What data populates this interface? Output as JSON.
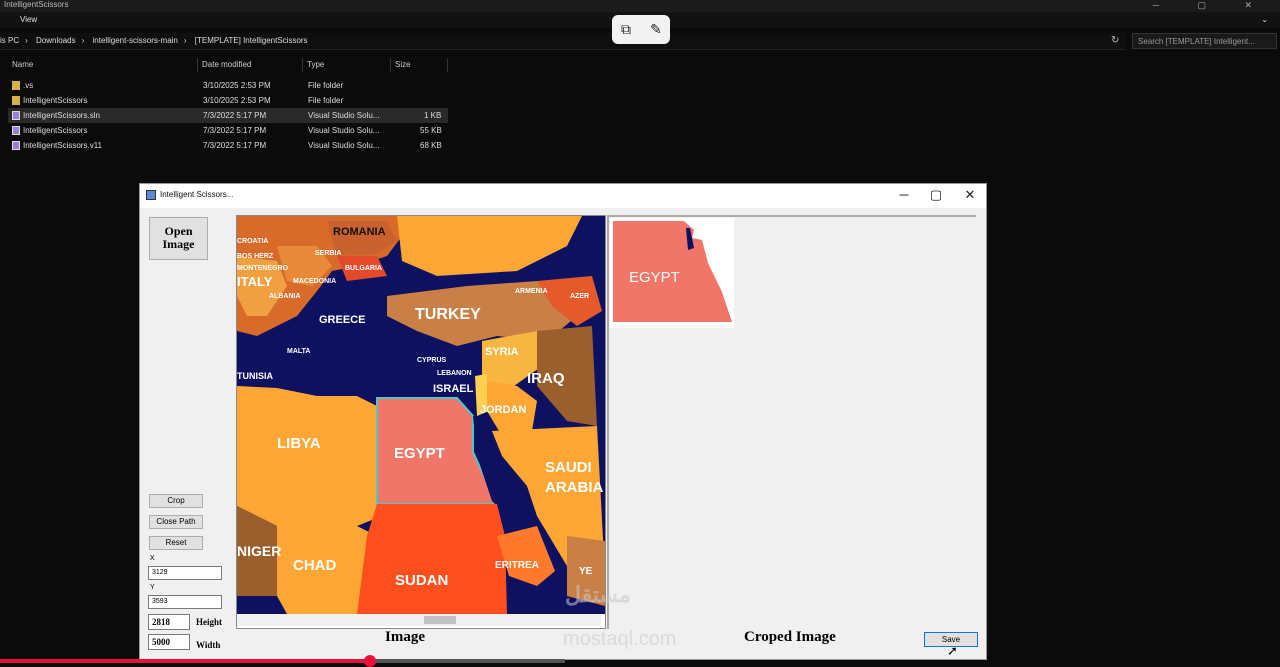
{
  "explorer": {
    "window_title": "IntelligentScissors",
    "menu_view": "View",
    "breadcrumb": [
      "is PC",
      "Downloads",
      "intelligent-scissors-main",
      "[TEMPLATE] IntelligentScissors"
    ],
    "search_placeholder": "Search [TEMPLATE] Intelligent...",
    "columns": [
      "Name",
      "Date modified",
      "Type",
      "Size"
    ],
    "files": [
      {
        "name": ".vs",
        "date": "3/10/2025 2:53 PM",
        "type": "File folder",
        "size": "",
        "icon": "folder-icon"
      },
      {
        "name": "IntelligentScissors",
        "date": "3/10/2025 2:53 PM",
        "type": "File folder",
        "size": "",
        "icon": "folder-icon"
      },
      {
        "name": "IntelligentScissors.sln",
        "date": "7/3/2022 5:17 PM",
        "type": "Visual Studio Solu...",
        "size": "1 KB",
        "icon": "solution-file-icon"
      },
      {
        "name": "IntelligentScissors",
        "date": "7/3/2022 5:17 PM",
        "type": "Visual Studio Solu...",
        "size": "55 KB",
        "icon": "solution-file-icon"
      },
      {
        "name": "IntelligentScissors.v11",
        "date": "7/3/2022 5:17 PM",
        "type": "Visual Studio Solu...",
        "size": "68 KB",
        "icon": "solution-file-icon"
      }
    ]
  },
  "app": {
    "title": "Intelligent Scissors...",
    "open_image_label": "Open Image",
    "crop_label": "Crop",
    "close_path_label": "Close Path",
    "reset_label": "Reset",
    "x_label": "X",
    "x_value": "3129",
    "y_label": "Y",
    "y_value": "3593",
    "height_value": "2818",
    "height_label": "Height",
    "width_value": "5000",
    "width_label": "Width",
    "image_caption": "Image",
    "cropped_caption": "Croped Image",
    "save_label": "Save"
  },
  "map_labels": {
    "romania": "ROMANIA",
    "serbia": "SERBIA",
    "bulgaria": "BULGARIA",
    "croatia": "CROATIA",
    "bosherz": "BOS HERZ",
    "montenegro": "MONTENEGRO",
    "macedonia": "MACEDONIA",
    "italy": "ITALY",
    "albania": "ALBANIA",
    "greece": "GREECE",
    "turkey": "TURKEY",
    "armenia": "ARMENIA",
    "azer": "AZER",
    "malta": "MALTA",
    "tunisia": "TUNISIA",
    "cyprus": "CYPRUS",
    "lebanon": "LEBANON",
    "syria": "SYRIA",
    "iraq": "IRAQ",
    "israel": "ISRAEL",
    "jordan": "JORDAN",
    "libya": "LIBYA",
    "egypt": "EGYPT",
    "saudi": "SAUDI ARABIA",
    "chad": "CHAD",
    "sudan": "SUDAN",
    "eritrea": "ERITREA",
    "niger": "NIGER",
    "yemen": "YE"
  },
  "cropped_label": "EGYPT",
  "watermark": {
    "arabic": "مستقل",
    "latin": "mostaql.com"
  },
  "video_progress": 0.655,
  "colors": {
    "sea": "#0d1160",
    "accent_red": "#e8103a",
    "egypt": "#f0766a"
  }
}
